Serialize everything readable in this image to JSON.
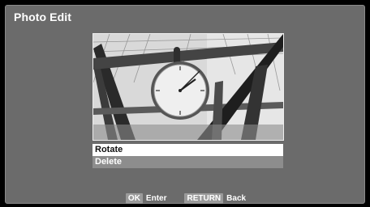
{
  "screen": {
    "title": "Photo Edit"
  },
  "photo": {
    "subject": "station-clock-photo"
  },
  "menu": {
    "items": [
      {
        "label": "Rotate",
        "selected": true
      },
      {
        "label": "Delete",
        "selected": false
      }
    ]
  },
  "footer": {
    "ok_key": "OK",
    "ok_label": "Enter",
    "return_key": "RETURN",
    "return_label": "Back"
  },
  "colors": {
    "panel": "#6b6b6b",
    "highlight": "#ffffff",
    "menu_normal": "#8d8d8d",
    "key_bg": "#9a9a9a"
  }
}
